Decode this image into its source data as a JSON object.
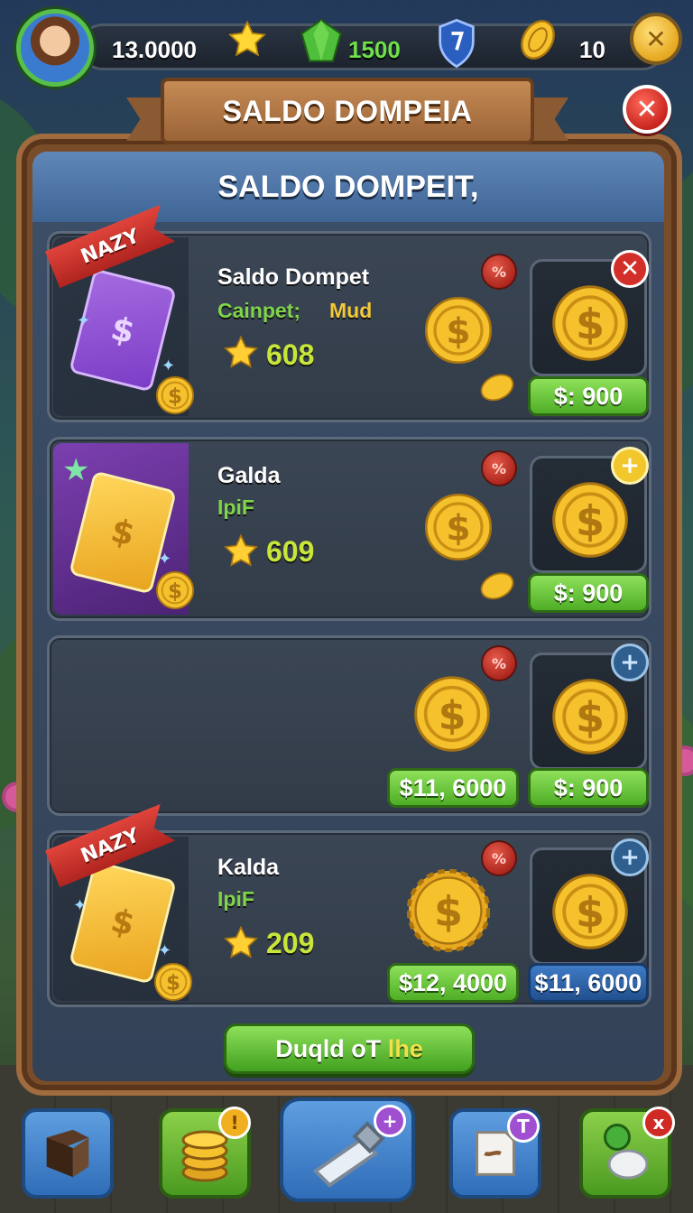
{
  "hud": {
    "coins": "13.0000",
    "gems": "1500",
    "tokens": "10",
    "icons": [
      "avatar",
      "star-icon",
      "gem-icon",
      "shield-icon",
      "coin-icon",
      "close-icon"
    ]
  },
  "banner": {
    "title": "SALDO DOMPEIA"
  },
  "panel": {
    "header": "SALDO DOMPEIT,"
  },
  "cards": [
    {
      "ribbon": "NAZY",
      "title": "Saldo Dompet",
      "subtitle_a": "Cainpet;",
      "subtitle_b": "Mud",
      "rating": "608",
      "price": "$: 900",
      "corner_icon": "close"
    },
    {
      "ribbon": "",
      "title": "Galda",
      "subtitle_a": "IpiF",
      "subtitle_b": "",
      "rating": "609",
      "price": "$: 900",
      "corner_icon": "plus"
    },
    {
      "ribbon": "",
      "title": "",
      "subtitle_a": "",
      "subtitle_b": "",
      "rating": "",
      "left_price": "$11, 6000",
      "price": "$: 900",
      "corner_icon": "plus"
    },
    {
      "ribbon": "NAZY",
      "title": "Kalda",
      "subtitle_a": "IpiF",
      "subtitle_b": "",
      "rating": "209",
      "left_price": "$12, 4000",
      "price": "$11, 6000",
      "corner_icon": "plus"
    }
  ],
  "action": {
    "label_a": "Duqld oT ",
    "label_b": "lhe"
  },
  "nav": {
    "badges": [
      "!",
      "+",
      "T",
      "x"
    ]
  },
  "colors": {
    "accent_green": "#57c04a",
    "gold": "#f2c72b",
    "wood": "#7a4d2a",
    "panel_blue": "#3c4f68"
  }
}
